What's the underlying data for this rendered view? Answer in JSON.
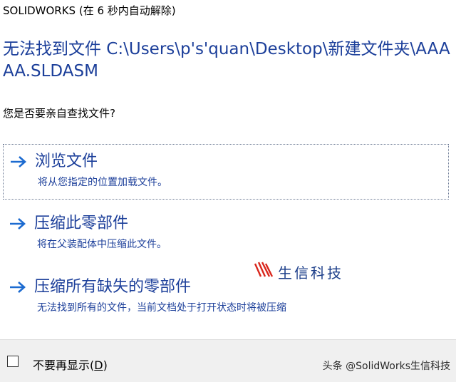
{
  "window": {
    "title": "SOLIDWORKS (在 6 秒内自动解除)"
  },
  "dialog": {
    "main_instruction": "无法找到文件 C:\\Users\\p's'quan\\Desktop\\新建文件夹\\AAAAA.SLDASM",
    "question": "您是否要亲自查找文件?",
    "commands": [
      {
        "title": "浏览文件",
        "description": "将从您指定的位置加载文件。",
        "selected": true,
        "icon": "right-arrow-icon"
      },
      {
        "title": "压缩此零部件",
        "description": "将在父装配体中压缩此文件。",
        "selected": false,
        "icon": "right-arrow-icon"
      },
      {
        "title": "压缩所有缺失的零部件",
        "description": "无法找到所有的文件，当前文档处于打开状态时将被压缩",
        "selected": false,
        "icon": "right-arrow-icon"
      }
    ]
  },
  "footer": {
    "checkbox_label": "不要再显示(",
    "checkbox_accel": "D",
    "checkbox_label_end": ")",
    "checkbox_checked": false,
    "credit": "头条 @SolidWorks生信科技"
  },
  "watermark": {
    "text": "生信科技",
    "color": "#1d3f8a",
    "logo_color": "#d9261c"
  },
  "colors": {
    "accent": "#1c3f9a",
    "footer_bg": "#f0f0f0"
  }
}
